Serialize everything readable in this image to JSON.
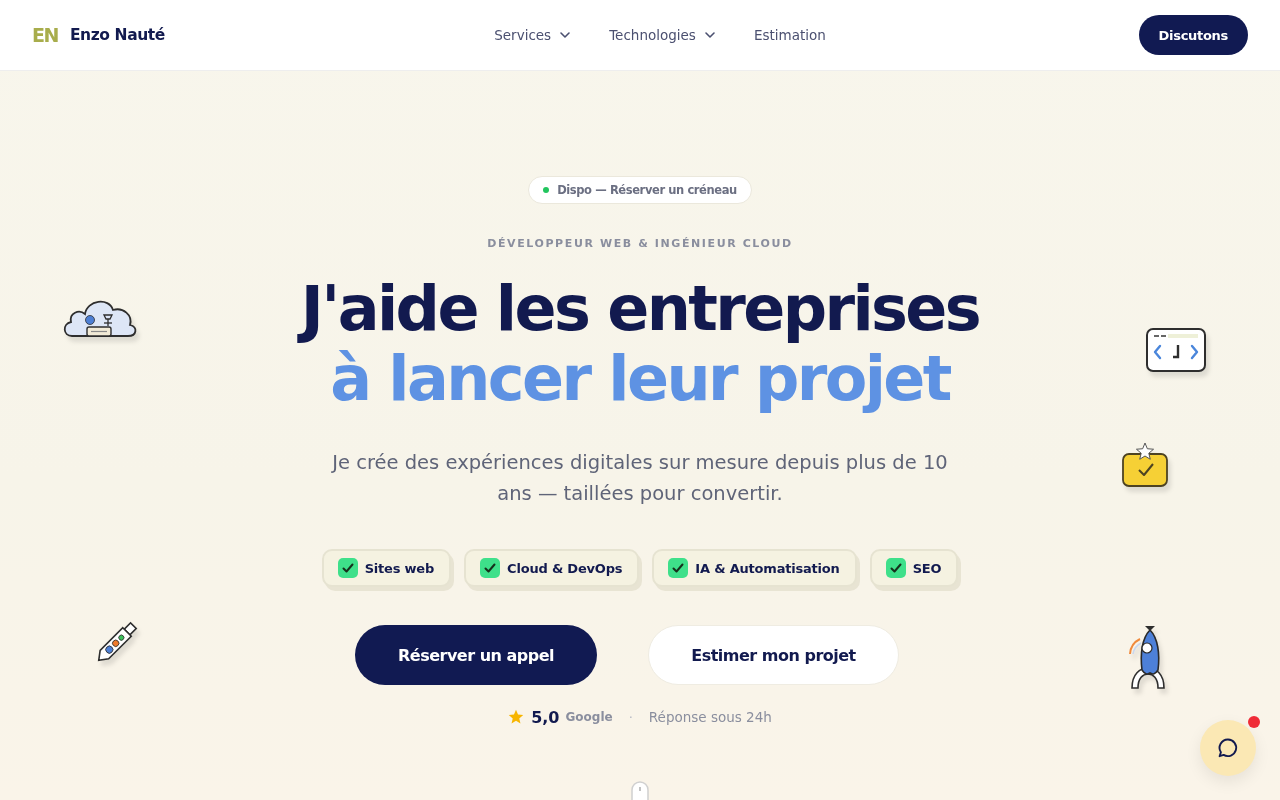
{
  "header": {
    "logo_mark": "EN",
    "brand": "Enzo Nauté",
    "nav": [
      {
        "label": "Services",
        "dropdown": true
      },
      {
        "label": "Technologies",
        "dropdown": true
      },
      {
        "label": "Estimation",
        "dropdown": false
      }
    ],
    "cta": "Discutons"
  },
  "hero": {
    "availability_badge": "Dispo — Réserver un créneau",
    "eyebrow": "DÉVELOPPEUR WEB & INGÉNIEUR CLOUD",
    "headline": [
      {
        "text": "J'aide les entreprises",
        "highlight": false
      },
      {
        "text": "à lancer leur projet",
        "highlight": true
      }
    ],
    "subtitle": "Je crée des expériences digitales sur mesure depuis plus de 10 ans — taillées pour convertir.",
    "tags": [
      "Sites web",
      "Cloud & DevOps",
      "IA & Automatisation",
      "SEO"
    ],
    "buttons": [
      {
        "label": "Réserver un appel",
        "kind": "primary"
      },
      {
        "label": "Estimer mon projet",
        "kind": "secondary"
      }
    ],
    "rating": {
      "score": "5,0",
      "source": "Google",
      "separator": "·",
      "response_time": "Réponse sous 24h"
    }
  },
  "chat_button": {
    "unread": true
  }
}
